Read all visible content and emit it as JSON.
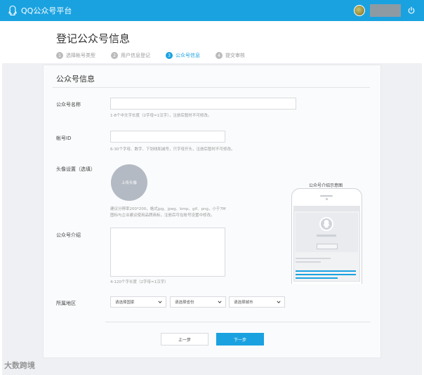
{
  "header": {
    "app_title": "QQ公众号平台"
  },
  "page": {
    "title": "登记公众号信息",
    "steps": [
      {
        "num": "1",
        "label": "选择帐号类型"
      },
      {
        "num": "2",
        "label": "用户信息登记"
      },
      {
        "num": "3",
        "label": "公众号信息"
      },
      {
        "num": "4",
        "label": "提交审核"
      }
    ],
    "active_step": 3
  },
  "form": {
    "section_title": "公众号信息",
    "name_label": "公众号名称",
    "name_hint": "1-8个中文字长度（2字母=1汉字），注册后暂时不可修改。",
    "id_label": "帐号ID",
    "id_hint": "6-30个字母、数字、下划线和减号，只字母开头，注册后暂时不可修改。",
    "avatar_label": "头像设置（选填）",
    "avatar_button": "上传头像",
    "avatar_hint_1": "建议分辨率200*200，格式jpg、jpeg、bmp、gif、png，小于7M",
    "avatar_hint_2": "图标与企业建议使用品牌商标，注册后可在帐号设置中修改。",
    "intro_label": "公众号介绍",
    "intro_hint": "4-120个字长度（2字母=1汉字）",
    "region_label": "所属地区",
    "country_select": "请选择国家",
    "province_select": "请选择省份",
    "city_select": "请选择城市",
    "prev_button": "上一步",
    "next_button": "下一步"
  },
  "preview": {
    "title": "公众号介绍示意图"
  },
  "watermark": "大数跨境",
  "colors": {
    "brand": "#1aa2e0",
    "page_bg": "#eef0f3"
  }
}
